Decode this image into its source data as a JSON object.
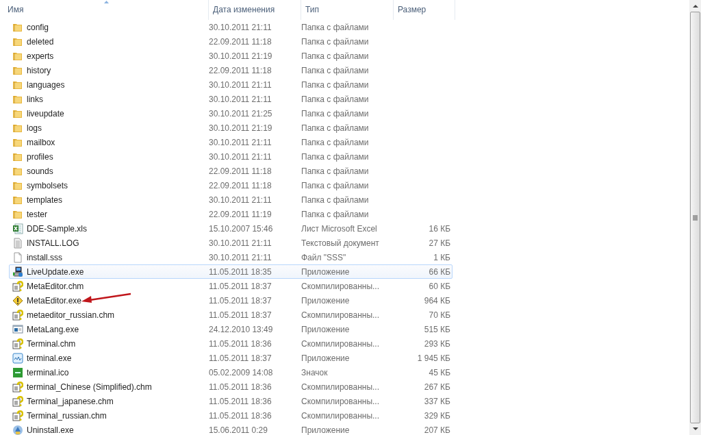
{
  "columns": [
    {
      "label": "Имя",
      "sorted": true
    },
    {
      "label": "Дата изменения",
      "sorted": false
    },
    {
      "label": "Тип",
      "sorted": false
    },
    {
      "label": "Размер",
      "sorted": false
    }
  ],
  "files": [
    {
      "kind": "folder",
      "name": "config",
      "date": "30.10.2011 21:11",
      "type": "Папка с файлами",
      "hovered": false,
      "arrow": false
    },
    {
      "kind": "folder",
      "name": "deleted",
      "date": "22.09.2011 11:18",
      "type": "Папка с файлами",
      "hovered": false,
      "arrow": false
    },
    {
      "kind": "folder",
      "name": "experts",
      "date": "30.10.2011 21:19",
      "type": "Папка с файлами",
      "hovered": false,
      "arrow": false
    },
    {
      "kind": "folder",
      "name": "history",
      "date": "22.09.2011 11:18",
      "type": "Папка с файлами",
      "hovered": false,
      "arrow": false
    },
    {
      "kind": "folder",
      "name": "languages",
      "date": "30.10.2011 21:11",
      "type": "Папка с файлами",
      "hovered": false,
      "arrow": false
    },
    {
      "kind": "folder",
      "name": "links",
      "date": "30.10.2011 21:11",
      "type": "Папка с файлами",
      "hovered": false,
      "arrow": false
    },
    {
      "kind": "folder",
      "name": "liveupdate",
      "date": "30.10.2011 21:25",
      "type": "Папка с файлами",
      "hovered": false,
      "arrow": false
    },
    {
      "kind": "folder",
      "name": "logs",
      "date": "30.10.2011 21:19",
      "type": "Папка с файлами",
      "hovered": false,
      "arrow": false
    },
    {
      "kind": "folder",
      "name": "mailbox",
      "date": "30.10.2011 21:11",
      "type": "Папка с файлами",
      "hovered": false,
      "arrow": false
    },
    {
      "kind": "folder",
      "name": "profiles",
      "date": "30.10.2011 21:11",
      "type": "Папка с файлами",
      "hovered": false,
      "arrow": false
    },
    {
      "kind": "folder",
      "name": "sounds",
      "date": "22.09.2011 11:18",
      "type": "Папка с файлами",
      "hovered": false,
      "arrow": false
    },
    {
      "kind": "folder",
      "name": "symbolsets",
      "date": "22.09.2011 11:18",
      "type": "Папка с файлами",
      "hovered": false,
      "arrow": false
    },
    {
      "kind": "folder",
      "name": "templates",
      "date": "30.10.2011 21:11",
      "type": "Папка с файлами",
      "hovered": false,
      "arrow": false
    },
    {
      "kind": "folder",
      "name": "tester",
      "date": "22.09.2011 11:19",
      "type": "Папка с файлами",
      "hovered": false,
      "arrow": false
    },
    {
      "kind": "spreadsheet",
      "name": "DDE-Sample.xls",
      "date": "15.10.2007 15:46",
      "type": "Лист Microsoft Excel",
      "size": "16 КБ",
      "hovered": false,
      "arrow": false
    },
    {
      "kind": "text",
      "name": "INSTALL.LOG",
      "date": "30.10.2011 21:11",
      "type": "Текстовый документ",
      "size": "27 КБ",
      "hovered": false,
      "arrow": false
    },
    {
      "kind": "blank",
      "name": "install.sss",
      "date": "30.10.2011 21:11",
      "type": "Файл \"SSS\"",
      "size": "1 КБ",
      "hovered": false,
      "arrow": false
    },
    {
      "kind": "computer",
      "name": "LiveUpdate.exe",
      "date": "11.05.2011 18:35",
      "type": "Приложение",
      "size": "66 КБ",
      "hovered": true,
      "arrow": false
    },
    {
      "kind": "help",
      "name": "MetaEditor.chm",
      "date": "11.05.2011 18:37",
      "type": "Скомпилированны...",
      "size": "60 КБ",
      "hovered": false,
      "arrow": false
    },
    {
      "kind": "warning",
      "name": "MetaEditor.exe",
      "date": "11.05.2011 18:37",
      "type": "Приложение",
      "size": "964 КБ",
      "hovered": false,
      "arrow": true
    },
    {
      "kind": "help",
      "name": "metaeditor_russian.chm",
      "date": "11.05.2011 18:37",
      "type": "Скомпилированны...",
      "size": "70 КБ",
      "hovered": false,
      "arrow": false
    },
    {
      "kind": "window",
      "name": "MetaLang.exe",
      "date": "24.12.2010 13:49",
      "type": "Приложение",
      "size": "515 КБ",
      "hovered": false,
      "arrow": false
    },
    {
      "kind": "help",
      "name": "Terminal.chm",
      "date": "11.05.2011 18:36",
      "type": "Скомпилированны...",
      "size": "293 КБ",
      "hovered": false,
      "arrow": false
    },
    {
      "kind": "chart",
      "name": "terminal.exe",
      "date": "11.05.2011 18:37",
      "type": "Приложение",
      "size": "1 945 КБ",
      "hovered": false,
      "arrow": false
    },
    {
      "kind": "image",
      "name": "terminal.ico",
      "date": "05.02.2009 14:08",
      "type": "Значок",
      "size": "45 КБ",
      "hovered": false,
      "arrow": false
    },
    {
      "kind": "help",
      "name": "terminal_Chinese (Simplified).chm",
      "date": "11.05.2011 18:36",
      "type": "Скомпилированны...",
      "size": "267 КБ",
      "hovered": false,
      "arrow": false
    },
    {
      "kind": "help",
      "name": "Terminal_japanese.chm",
      "date": "11.05.2011 18:36",
      "type": "Скомпилированны...",
      "size": "337 КБ",
      "hovered": false,
      "arrow": false
    },
    {
      "kind": "help",
      "name": "Terminal_russian.chm",
      "date": "11.05.2011 18:36",
      "type": "Скомпилированны...",
      "size": "329 КБ",
      "hovered": false,
      "arrow": false
    },
    {
      "kind": "installer",
      "name": "Uninstall.exe",
      "date": "15.06.2011 0:29",
      "type": "Приложение",
      "size": "207 КБ",
      "hovered": false,
      "arrow": false
    }
  ]
}
